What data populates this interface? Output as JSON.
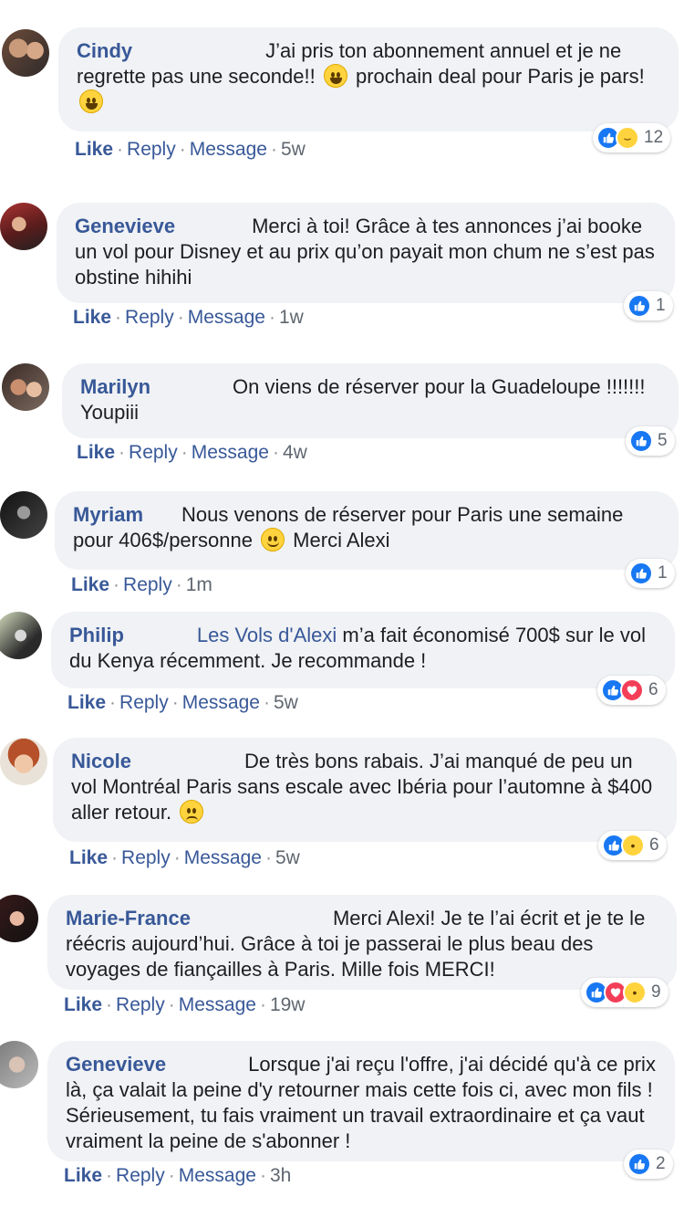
{
  "comments": [
    {
      "name": "Cindy",
      "text_parts": [
        "J’ai pris ton abonnement annuel et je ne regrette pas une seconde!! ",
        " prochain deal pour Paris je pars! ",
        ""
      ],
      "emojis": [
        "grin-emoji",
        "grin-emoji"
      ],
      "actions": [
        "Like",
        "Reply",
        "Message"
      ],
      "time": "5w",
      "reactions": [
        "like",
        "haha"
      ],
      "reaction_count": "12"
    },
    {
      "name": "Genevieve",
      "text": "Merci à toi! Grâce à tes annonces j’ai booke un vol pour Disney et au prix qu’on payait mon chum ne s’est pas obstine hihihi",
      "actions": [
        "Like",
        "Reply",
        "Message"
      ],
      "time": "1w",
      "reactions": [
        "like"
      ],
      "reaction_count": "1"
    },
    {
      "name": "Marilyn",
      "text": "On viens de réserver pour la Guadeloupe !!!!!!! Youpiii",
      "actions": [
        "Like",
        "Reply",
        "Message"
      ],
      "time": "4w",
      "reactions": [
        "like"
      ],
      "reaction_count": "5"
    },
    {
      "name": "Myriam",
      "text_parts": [
        "Nous venons de réserver pour Paris une semaine pour 406$/personne ",
        " Merci Alexi"
      ],
      "emojis": [
        "smile-emoji"
      ],
      "actions": [
        "Like",
        "Reply"
      ],
      "time": "1m",
      "reactions": [
        "like"
      ],
      "reaction_count": "1"
    },
    {
      "name": "Philip",
      "mention": "Les Vols d'Alexi",
      "text": "m’a fait économisé 700$ sur le vol du Kenya récemment. Je recommande !",
      "actions": [
        "Like",
        "Reply",
        "Message"
      ],
      "time": "5w",
      "reactions": [
        "like",
        "love"
      ],
      "reaction_count": "6"
    },
    {
      "name": "Nicole",
      "text_parts": [
        "De très bons rabais. J’ai manqué de peu un vol Montréal Paris sans escale avec Ibéria pour l’automne à $400 aller retour. ",
        ""
      ],
      "emojis": [
        "sad-emoji"
      ],
      "actions": [
        "Like",
        "Reply",
        "Message"
      ],
      "time": "5w",
      "reactions": [
        "like",
        "wow"
      ],
      "reaction_count": "6"
    },
    {
      "name": "Marie-France",
      "text": "Merci Alexi! Je te l’ai écrit et je te le réécris aujourd’hui. Grâce à toi je passerai le plus beau des voyages de fiançailles à Paris. Mille fois MERCI!",
      "actions": [
        "Like",
        "Reply",
        "Message"
      ],
      "time": "19w",
      "reactions": [
        "like",
        "love",
        "wow"
      ],
      "reaction_count": "9"
    },
    {
      "name": "Genevieve",
      "text": "Lorsque j'ai reçu l'offre, j'ai décidé qu'à ce prix là, ça valait la peine d'y retourner mais cette fois ci, avec mon fils ! Sérieusement, tu fais vraiment un travail extraordinaire et ça vaut vraiment la peine de s'abonner !",
      "actions": [
        "Like",
        "Reply",
        "Message"
      ],
      "time": "3h",
      "reactions": [
        "like"
      ],
      "reaction_count": "2"
    }
  ],
  "colors": {
    "link": "#385898",
    "bubble": "#f0f2f5",
    "like": "#1877f2",
    "love": "#f33e58",
    "emoji": "#ffd33d"
  }
}
